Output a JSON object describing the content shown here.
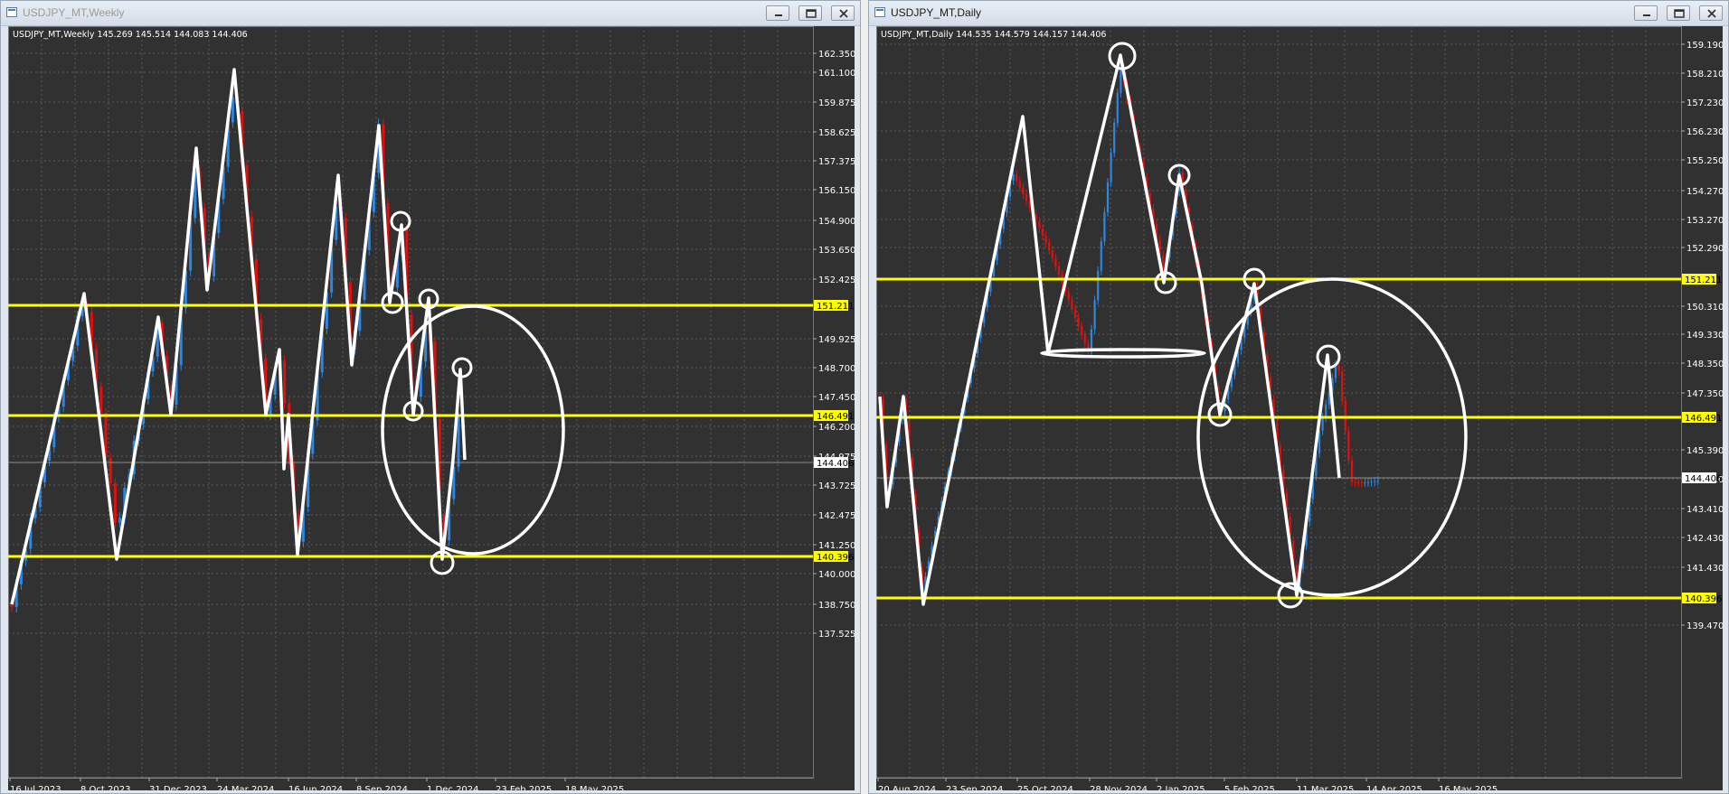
{
  "windows": [
    {
      "title": "USDJPY_MT,Weekly",
      "title_active": false,
      "info": "USDJPY_MT,Weekly  145.269 145.514 144.083 144.406",
      "price_labels": [
        "162.350",
        "161.100",
        "159.875",
        "158.625",
        "157.375",
        "156.150",
        "154.900",
        "153.650",
        "152.425",
        "149.925",
        "148.700",
        "147.450",
        "146.200",
        "144.975",
        "143.725",
        "142.475",
        "141.250",
        "140.000",
        "138.750",
        "137.525"
      ],
      "level_labels": [
        "151.211",
        "146.491",
        "140.396"
      ],
      "current_price": "144.406",
      "date_labels": [
        "16 Jul 2023",
        "8 Oct 2023",
        "31 Dec 2023",
        "24 Mar 2024",
        "16 Jun 2024",
        "8 Sep 2024",
        "1 Dec 2024",
        "23 Feb 2025",
        "18 May 2025"
      ]
    },
    {
      "title": "USDJPY_MT,Daily",
      "title_active": true,
      "info": "USDJPY_MT,Daily  144.535 144.579 144.157 144.406",
      "price_labels": [
        "159.190",
        "158.210",
        "157.230",
        "156.230",
        "155.250",
        "154.270",
        "153.270",
        "152.290",
        "150.310",
        "149.330",
        "148.350",
        "147.350",
        "145.390",
        "144.410",
        "143.410",
        "142.430",
        "141.430",
        "139.470"
      ],
      "level_labels": [
        "151.211",
        "146.491",
        "140.396"
      ],
      "current_price": "144.406",
      "date_labels": [
        "20 Aug 2024",
        "23 Sep 2024",
        "25 Oct 2024",
        "28 Nov 2024",
        "2 Jan 2025",
        "5 Feb 2025",
        "11 Mar 2025",
        "14 Apr 2025",
        "16 May 2025"
      ]
    }
  ],
  "colors": {
    "chart_bg": "#313131",
    "grid": "#5c5c5c",
    "bull": "#2e86de",
    "bear": "#e01010",
    "level": "#ffff00",
    "drawing": "#ffffff"
  },
  "icons": {
    "title": "chart-window-icon",
    "minimize": "minimize-icon",
    "maximize": "maximize-icon",
    "close": "close-icon"
  }
}
